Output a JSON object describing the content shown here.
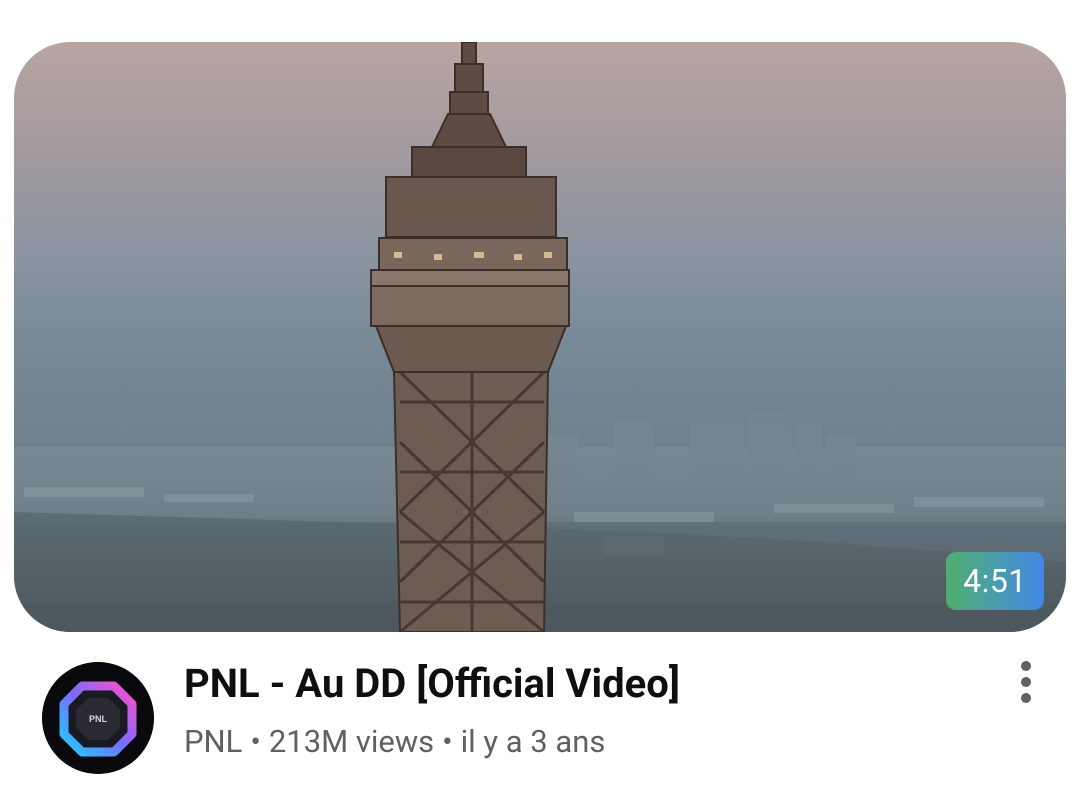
{
  "video": {
    "title": "PNL - Au DD [Official Video]",
    "duration": "4:51",
    "thumbnail_icon": "eiffel-tower-thumbnail",
    "channel": {
      "name": "PNL",
      "avatar_text": "PNL",
      "avatar_icon": "pnl-octagon-logo"
    },
    "views": "213M views",
    "age": "il y a 3 ans",
    "separator": "•"
  },
  "menu": {
    "icon": "more-vert-icon"
  },
  "colors": {
    "title": "#0f0f0f",
    "meta": "#606060",
    "duration_badge_start": "#4fae6d",
    "duration_badge_end": "#4386e6"
  }
}
